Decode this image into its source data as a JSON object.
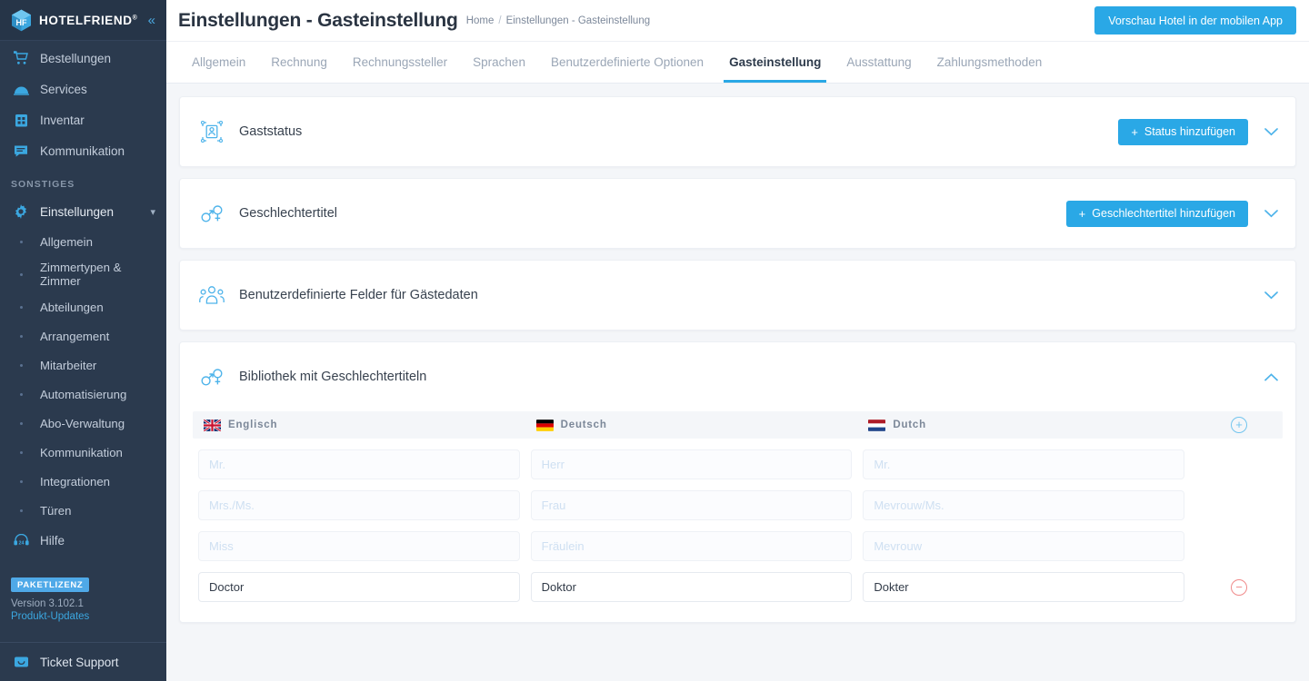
{
  "sidebar": {
    "brand": {
      "name": "HOTELFRIEND",
      "reg": "®",
      "collapse_icon": "double-chevron-left"
    },
    "top_items": [
      {
        "label": "Bestellungen",
        "icon": "cart-icon"
      },
      {
        "label": "Services",
        "icon": "room-service-icon"
      },
      {
        "label": "Inventar",
        "icon": "building-icon"
      },
      {
        "label": "Kommunikation",
        "icon": "chat-icon"
      }
    ],
    "section_label": "SONSTIGES",
    "settings": {
      "label": "Einstellungen",
      "icon": "gear-icon",
      "caret": "chevron-down-icon"
    },
    "sub_items": [
      {
        "label": "Allgemein"
      },
      {
        "label": "Zimmertypen & Zimmer"
      },
      {
        "label": "Abteilungen"
      },
      {
        "label": "Arrangement"
      },
      {
        "label": "Mitarbeiter"
      },
      {
        "label": "Automatisierung"
      },
      {
        "label": "Abo-Verwaltung"
      },
      {
        "label": "Kommunikation"
      },
      {
        "label": "Integrationen"
      },
      {
        "label": "Türen"
      }
    ],
    "help": {
      "label": "Hilfe",
      "icon": "headset-24-icon"
    },
    "license_badge": "PAKETLIZENZ",
    "version": "Version 3.102.1",
    "product_updates": "Produkt-Updates",
    "ticket_support": {
      "label": "Ticket Support",
      "icon": "chat-box-icon"
    }
  },
  "header": {
    "title": "Einstellungen - Gasteinstellung",
    "breadcrumb": [
      "Home",
      "Einstellungen - Gasteinstellung"
    ],
    "breadcrumb_separator": "/",
    "preview_button": "Vorschau Hotel in der mobilen App"
  },
  "tabs": [
    {
      "label": "Allgemein",
      "active": false
    },
    {
      "label": "Rechnung",
      "active": false
    },
    {
      "label": "Rechnungssteller",
      "active": false
    },
    {
      "label": "Sprachen",
      "active": false
    },
    {
      "label": "Benutzerdefinierte Optionen",
      "active": false
    },
    {
      "label": "Gasteinstellung",
      "active": true
    },
    {
      "label": "Ausstattung",
      "active": false
    },
    {
      "label": "Zahlungsmethoden",
      "active": false
    }
  ],
  "cards": [
    {
      "title": "Gaststatus",
      "icon": "guest-status-icon",
      "button": "Status hinzufügen",
      "button_plus": "+",
      "chevron": "chevron-down-icon"
    },
    {
      "title": "Geschlechtertitel",
      "icon": "gender-icon",
      "button": "Geschlechtertitel hinzufügen",
      "button_plus": "+",
      "chevron": "chevron-down-icon"
    },
    {
      "title": "Benutzerdefinierte Felder für Gästedaten",
      "icon": "people-icon",
      "button": null,
      "chevron": "chevron-down-icon"
    }
  ],
  "library": {
    "title": "Bibliothek mit Geschlechtertiteln",
    "icon": "gender-icon",
    "chevron": "chevron-up-icon",
    "columns": [
      {
        "label": "Englisch",
        "flag": "flag-uk"
      },
      {
        "label": "Deutsch",
        "flag": "flag-de"
      },
      {
        "label": "Dutch",
        "flag": "flag-nl"
      }
    ],
    "add_row_icon": "plus-circle-icon",
    "remove_row_icon": "minus-circle-icon",
    "rows": [
      {
        "disabled": true,
        "cells": [
          "Mr.",
          "Herr",
          "Mr."
        ],
        "has_remove": false
      },
      {
        "disabled": true,
        "cells": [
          "Mrs./Ms.",
          "Frau",
          "Mevrouw/Ms."
        ],
        "has_remove": false
      },
      {
        "disabled": true,
        "cells": [
          "Miss",
          "Fräulein",
          "Mevrouw"
        ],
        "has_remove": false
      },
      {
        "disabled": false,
        "cells": [
          "Doctor",
          "Doktor",
          "Dokter"
        ],
        "has_remove": true
      }
    ]
  },
  "colors": {
    "accent": "#2aa8e6",
    "sidebar_bg": "#2b3a4e",
    "page_bg": "#f4f6f9",
    "danger": "#f08a8a"
  }
}
